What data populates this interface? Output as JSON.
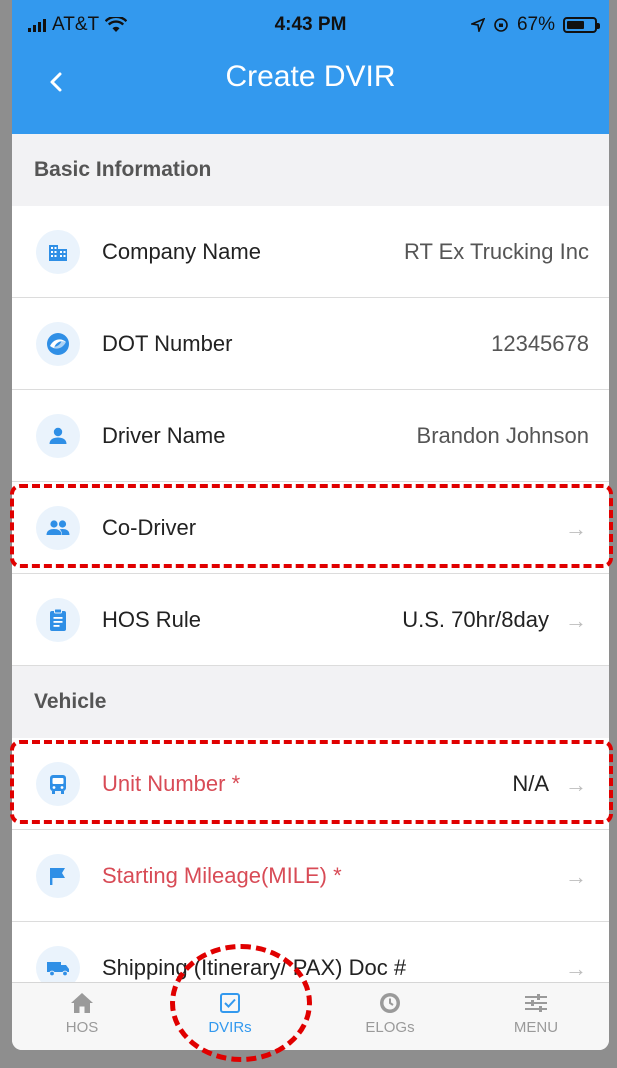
{
  "status_bar": {
    "carrier": "AT&T",
    "time": "4:43 PM",
    "battery": "67%",
    "battery_level": 0.67
  },
  "header": {
    "title": "Create DVIR"
  },
  "sections": {
    "basic": "Basic Information",
    "vehicle": "Vehicle"
  },
  "rows": {
    "company": {
      "label": "Company Name",
      "value": "RT Ex Trucking Inc",
      "icon": "building-icon"
    },
    "dot": {
      "label": "DOT Number",
      "value": "12345678",
      "icon": "dot-logo-icon"
    },
    "driver": {
      "label": "Driver Name",
      "value": "Brandon Johnson",
      "icon": "person-icon"
    },
    "codriver": {
      "label": "Co-Driver",
      "value": "",
      "icon": "people-icon"
    },
    "hos_rule": {
      "label": "HOS Rule",
      "value": "U.S. 70hr/8day",
      "icon": "clipboard-icon"
    },
    "unit": {
      "label": "Unit Number *",
      "value": "N/A",
      "icon": "bus-icon"
    },
    "mileage": {
      "label": "Starting Mileage(MILE) *",
      "value": "",
      "icon": "flag-icon"
    },
    "shipping": {
      "label": "Shipping (Itinerary/ PAX) Doc #",
      "value": "",
      "icon": "truck-icon"
    }
  },
  "arrow_glyph": "→",
  "tabs": {
    "hos": "HOS",
    "dvirs": "DVIRs",
    "elogs": "ELOGs",
    "menu": "MENU"
  },
  "colors": {
    "accent": "#3399ee",
    "required": "#d84b56",
    "highlight": "#e00000"
  }
}
